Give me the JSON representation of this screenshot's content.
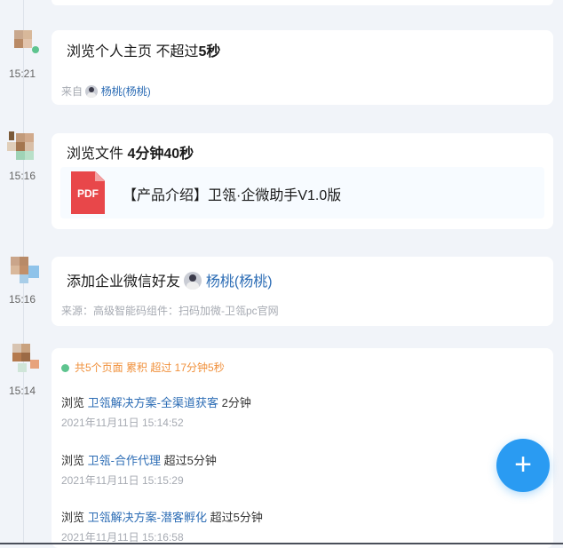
{
  "timeline": [
    {
      "time": "15:21",
      "title_prefix": "浏览个人主页 不超过",
      "title_bold": "5秒",
      "source_label": "来自",
      "source_user": "杨桃(杨桃)"
    },
    {
      "time": "15:16",
      "title_prefix": "浏览文件 ",
      "title_bold": "4分钟40秒",
      "file_type": "PDF",
      "file_name": "【产品介绍】卫瓴·企微助手V1.0版"
    },
    {
      "time": "15:16",
      "title_prefix": "添加企业微信好友",
      "user": "杨桃(杨桃)",
      "source": "来源：高级智能码组件：扫码加微-卫瓴pc官网"
    },
    {
      "time": "15:14",
      "summary": "共5个页面   累积 超过 17分钟5秒",
      "visits": [
        {
          "verb": "浏览",
          "page": "卫瓴解决方案-全渠道获客",
          "duration": "2分钟",
          "datetime": "2021年11月11日 15:14:52"
        },
        {
          "verb": "浏览",
          "page": "卫瓴-合作代理",
          "duration": "超过5分钟",
          "datetime": "2021年11月11日 15:15:29"
        },
        {
          "verb": "浏览",
          "page": "卫瓴解决方案-潜客孵化",
          "duration": "超过5分钟",
          "datetime": "2021年11月11日 15:16:58"
        }
      ]
    }
  ],
  "fab": {
    "icon": "plus-icon",
    "symbol": "+"
  },
  "colors": {
    "accent": "#2a9bf2",
    "link": "#2d6db5",
    "summary": "#f0903b",
    "dot": "#5ec48f",
    "pdf": "#e8474a"
  }
}
